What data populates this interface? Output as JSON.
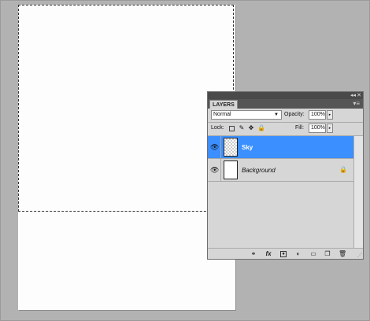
{
  "panel": {
    "title": "LAYERS",
    "blend_mode": "Normal",
    "opacity_label": "Opacity:",
    "opacity_value": "100%",
    "lock_label": "Lock:",
    "fill_label": "Fill:",
    "fill_value": "100%",
    "layers": [
      {
        "name": "Sky",
        "selected": true,
        "visible": true,
        "locked": false,
        "thumbnail": "transparent-checker"
      },
      {
        "name": "Background",
        "selected": false,
        "visible": true,
        "locked": true,
        "thumbnail": "white"
      }
    ],
    "selected_color": "#3c8fff"
  },
  "icons": {
    "eye": "eye-icon",
    "lock": "lock-icon",
    "link": "link-layers-icon",
    "fx": "fx",
    "mask": "add-mask-icon",
    "adjustment": "adjustment-layer-icon",
    "group": "new-group-icon",
    "new_layer": "new-layer-icon",
    "trash": "trash-icon"
  }
}
